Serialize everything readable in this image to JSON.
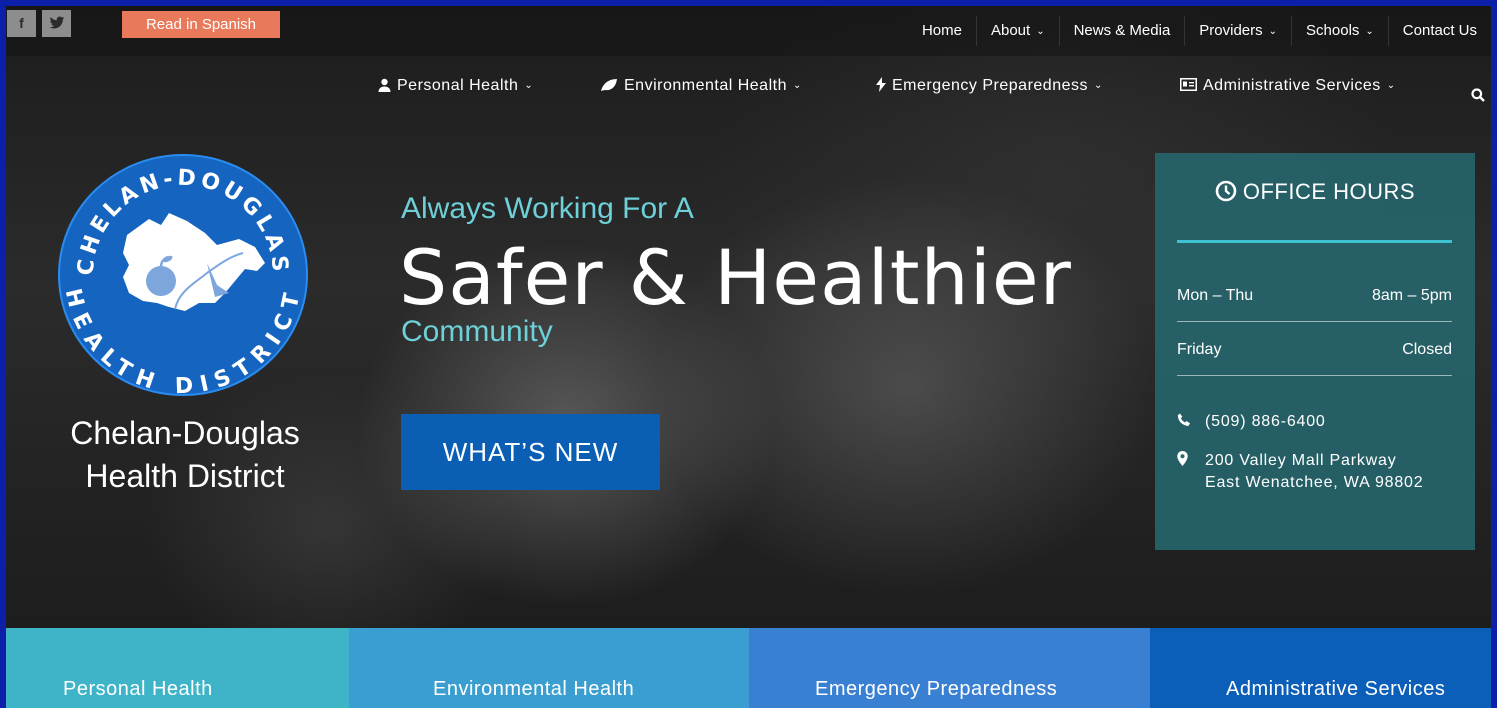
{
  "utility": {
    "facebook": "f",
    "twitter": "t",
    "spanish_label": "Read in Spanish"
  },
  "topnav": [
    {
      "label": "Home",
      "dropdown": false
    },
    {
      "label": "About",
      "dropdown": true
    },
    {
      "label": "News & Media",
      "dropdown": false
    },
    {
      "label": "Providers",
      "dropdown": true
    },
    {
      "label": "Schools",
      "dropdown": true
    },
    {
      "label": "Contact Us",
      "dropdown": false
    }
  ],
  "mainnav": [
    {
      "label": "Personal Health",
      "icon": "person-icon"
    },
    {
      "label": "Environmental Health",
      "icon": "leaf-icon"
    },
    {
      "label": "Emergency Preparedness",
      "icon": "bolt-icon"
    },
    {
      "label": "Administrative Services",
      "icon": "id-card-icon"
    }
  ],
  "logo": {
    "ring_top": "CHELAN-DOUGLAS",
    "ring_bottom": "HEALTH DISTRICT",
    "name_line1": "Chelan-Douglas",
    "name_line2": "Health District"
  },
  "hero": {
    "line1": "Always Working For A",
    "line2": "Safer & Healthier",
    "line3": "Community",
    "button": "WHAT’S NEW"
  },
  "hours": {
    "title": "OFFICE HOURS",
    "rows": [
      {
        "day": "Mon – Thu",
        "time": "8am – 5pm"
      },
      {
        "day": "Friday",
        "time": "Closed"
      }
    ],
    "phone": "(509) 886-6400",
    "address_line1": "200 Valley Mall Parkway",
    "address_line2": "East Wenatchee, WA 98802"
  },
  "tiles": [
    "Personal Health",
    "Environmental Health",
    "Emergency Preparedness",
    "Administrative Services"
  ],
  "colors": {
    "accent_teal": "#6ed0d8",
    "button_blue": "#0a5fb5",
    "spanish_orange": "#e8795a",
    "logo_blue": "#1565c0"
  }
}
